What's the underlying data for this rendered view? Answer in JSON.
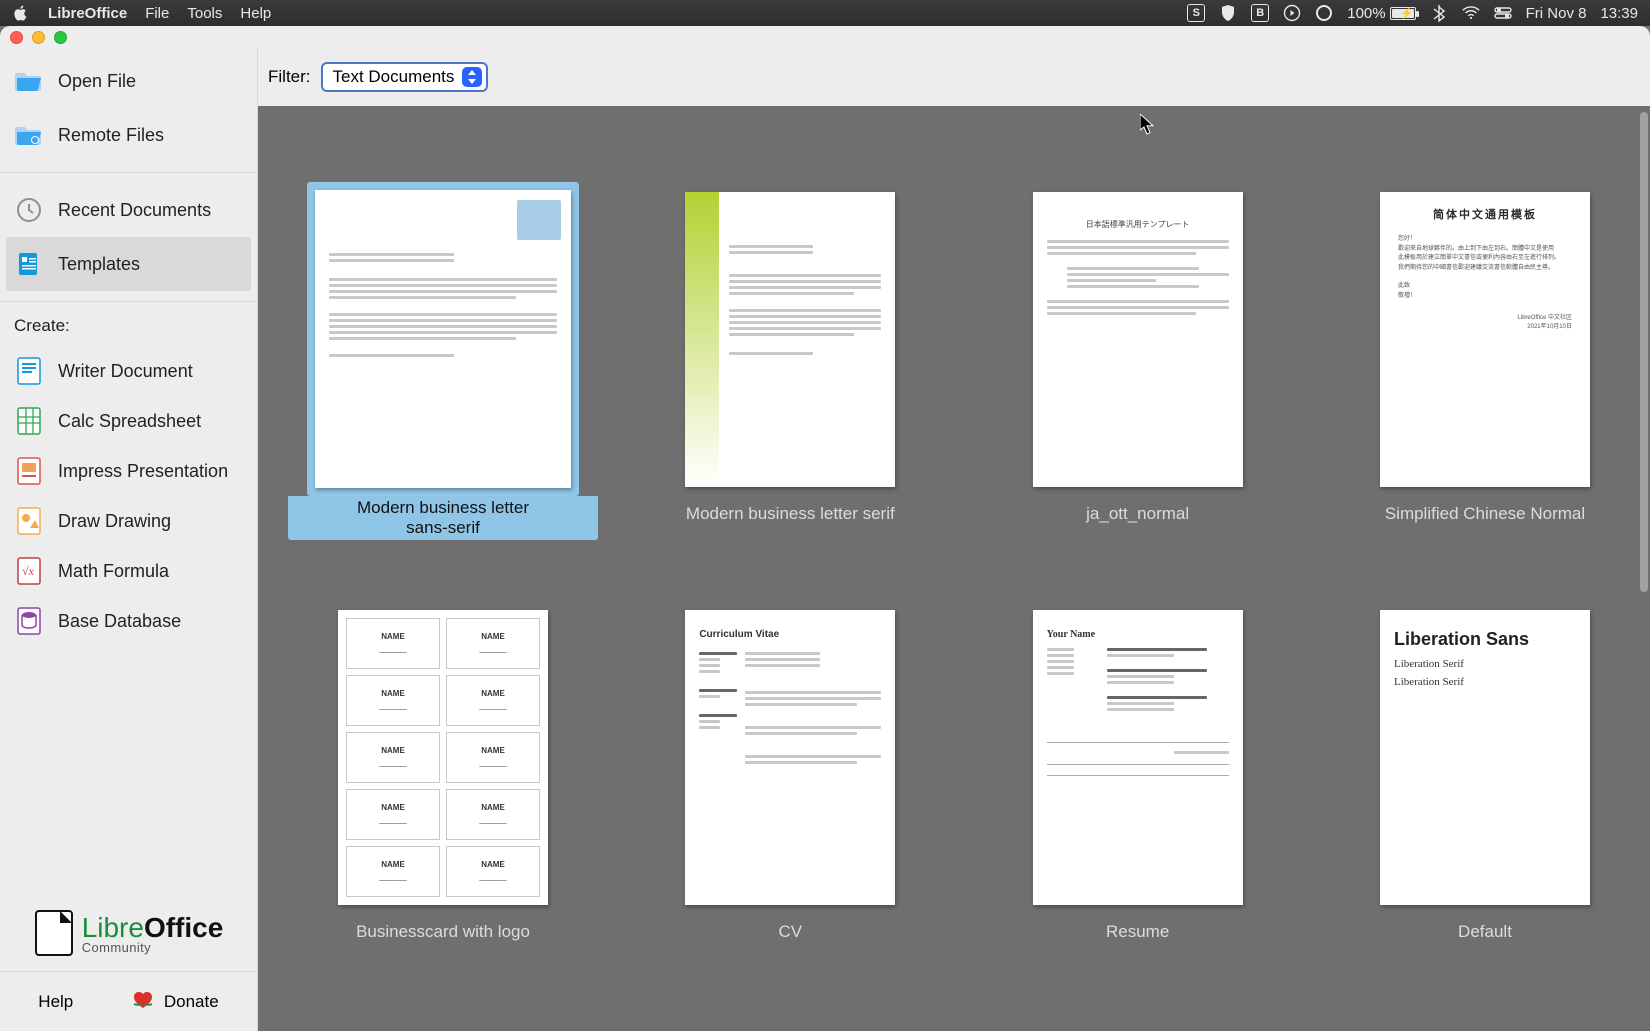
{
  "menubar": {
    "app_name": "LibreOffice",
    "items": [
      "File",
      "Tools",
      "Help"
    ],
    "battery_pct": "100%",
    "date": "Fri Nov 8",
    "time": "13:39",
    "status_letter_s": "S",
    "status_letter_b": "B"
  },
  "sidebar": {
    "open_file": "Open File",
    "remote_files": "Remote Files",
    "recent_documents": "Recent Documents",
    "templates": "Templates",
    "create_label": "Create:",
    "writer": "Writer Document",
    "calc": "Calc Spreadsheet",
    "impress": "Impress Presentation",
    "draw": "Draw Drawing",
    "math": "Math Formula",
    "base": "Base Database",
    "logo_thin": "Libre",
    "logo_bold": "Office",
    "logo_sub": "Community",
    "help": "Help",
    "donate": "Donate"
  },
  "filter": {
    "label": "Filter:",
    "value": "Text Documents"
  },
  "templates": [
    {
      "name": "Modern business letter sans-serif",
      "selected": true
    },
    {
      "name": "Modern business letter serif",
      "selected": false
    },
    {
      "name": "ja_ott_normal",
      "selected": false
    },
    {
      "name": "Simplified Chinese Normal",
      "selected": false
    },
    {
      "name": "Businesscard with logo",
      "selected": false
    },
    {
      "name": "CV",
      "selected": false
    },
    {
      "name": "Resume",
      "selected": false
    },
    {
      "name": "Default",
      "selected": false
    }
  ],
  "preview_text": {
    "chinese_title": "简体中文通用模板",
    "japanese_title": "日本語標準汎用テンプレート",
    "liber_sans": "Liberation Sans",
    "liber_serif": "Liberation Serif",
    "cv_heading": "Curriculum Vitae",
    "resume_heading": "Your Name",
    "card_name": "NAME"
  }
}
